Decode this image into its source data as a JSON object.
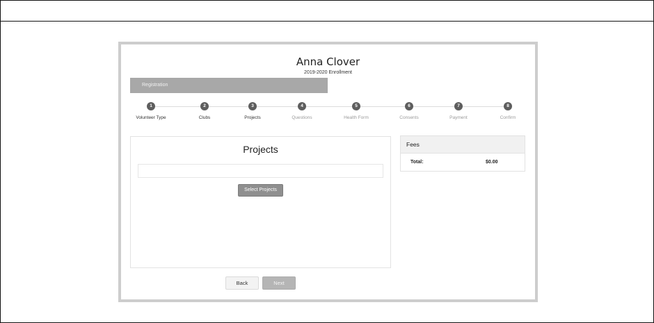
{
  "header": {
    "name": "Anna Clover",
    "subtitle": "2019-2020 Enrollment"
  },
  "progress": {
    "label": "Registration",
    "fraction": 0.5
  },
  "steps": [
    {
      "number": "1",
      "label": "Volunteer Type",
      "status": "done"
    },
    {
      "number": "2",
      "label": "Clubs",
      "status": "done"
    },
    {
      "number": "3",
      "label": "Projects",
      "status": "current"
    },
    {
      "number": "4",
      "label": "Questions",
      "status": "upcoming"
    },
    {
      "number": "5",
      "label": "Health Form",
      "status": "upcoming"
    },
    {
      "number": "6",
      "label": "Consents",
      "status": "upcoming"
    },
    {
      "number": "7",
      "label": "Payment",
      "status": "upcoming"
    },
    {
      "number": "8",
      "label": "Confirm",
      "status": "upcoming"
    }
  ],
  "projects": {
    "title": "Projects",
    "select_button": "Select Projects"
  },
  "fees": {
    "title": "Fees",
    "total_label": "Total:",
    "total_value": "$0.00"
  },
  "nav": {
    "back_label": "Back",
    "next_label": "Next"
  }
}
